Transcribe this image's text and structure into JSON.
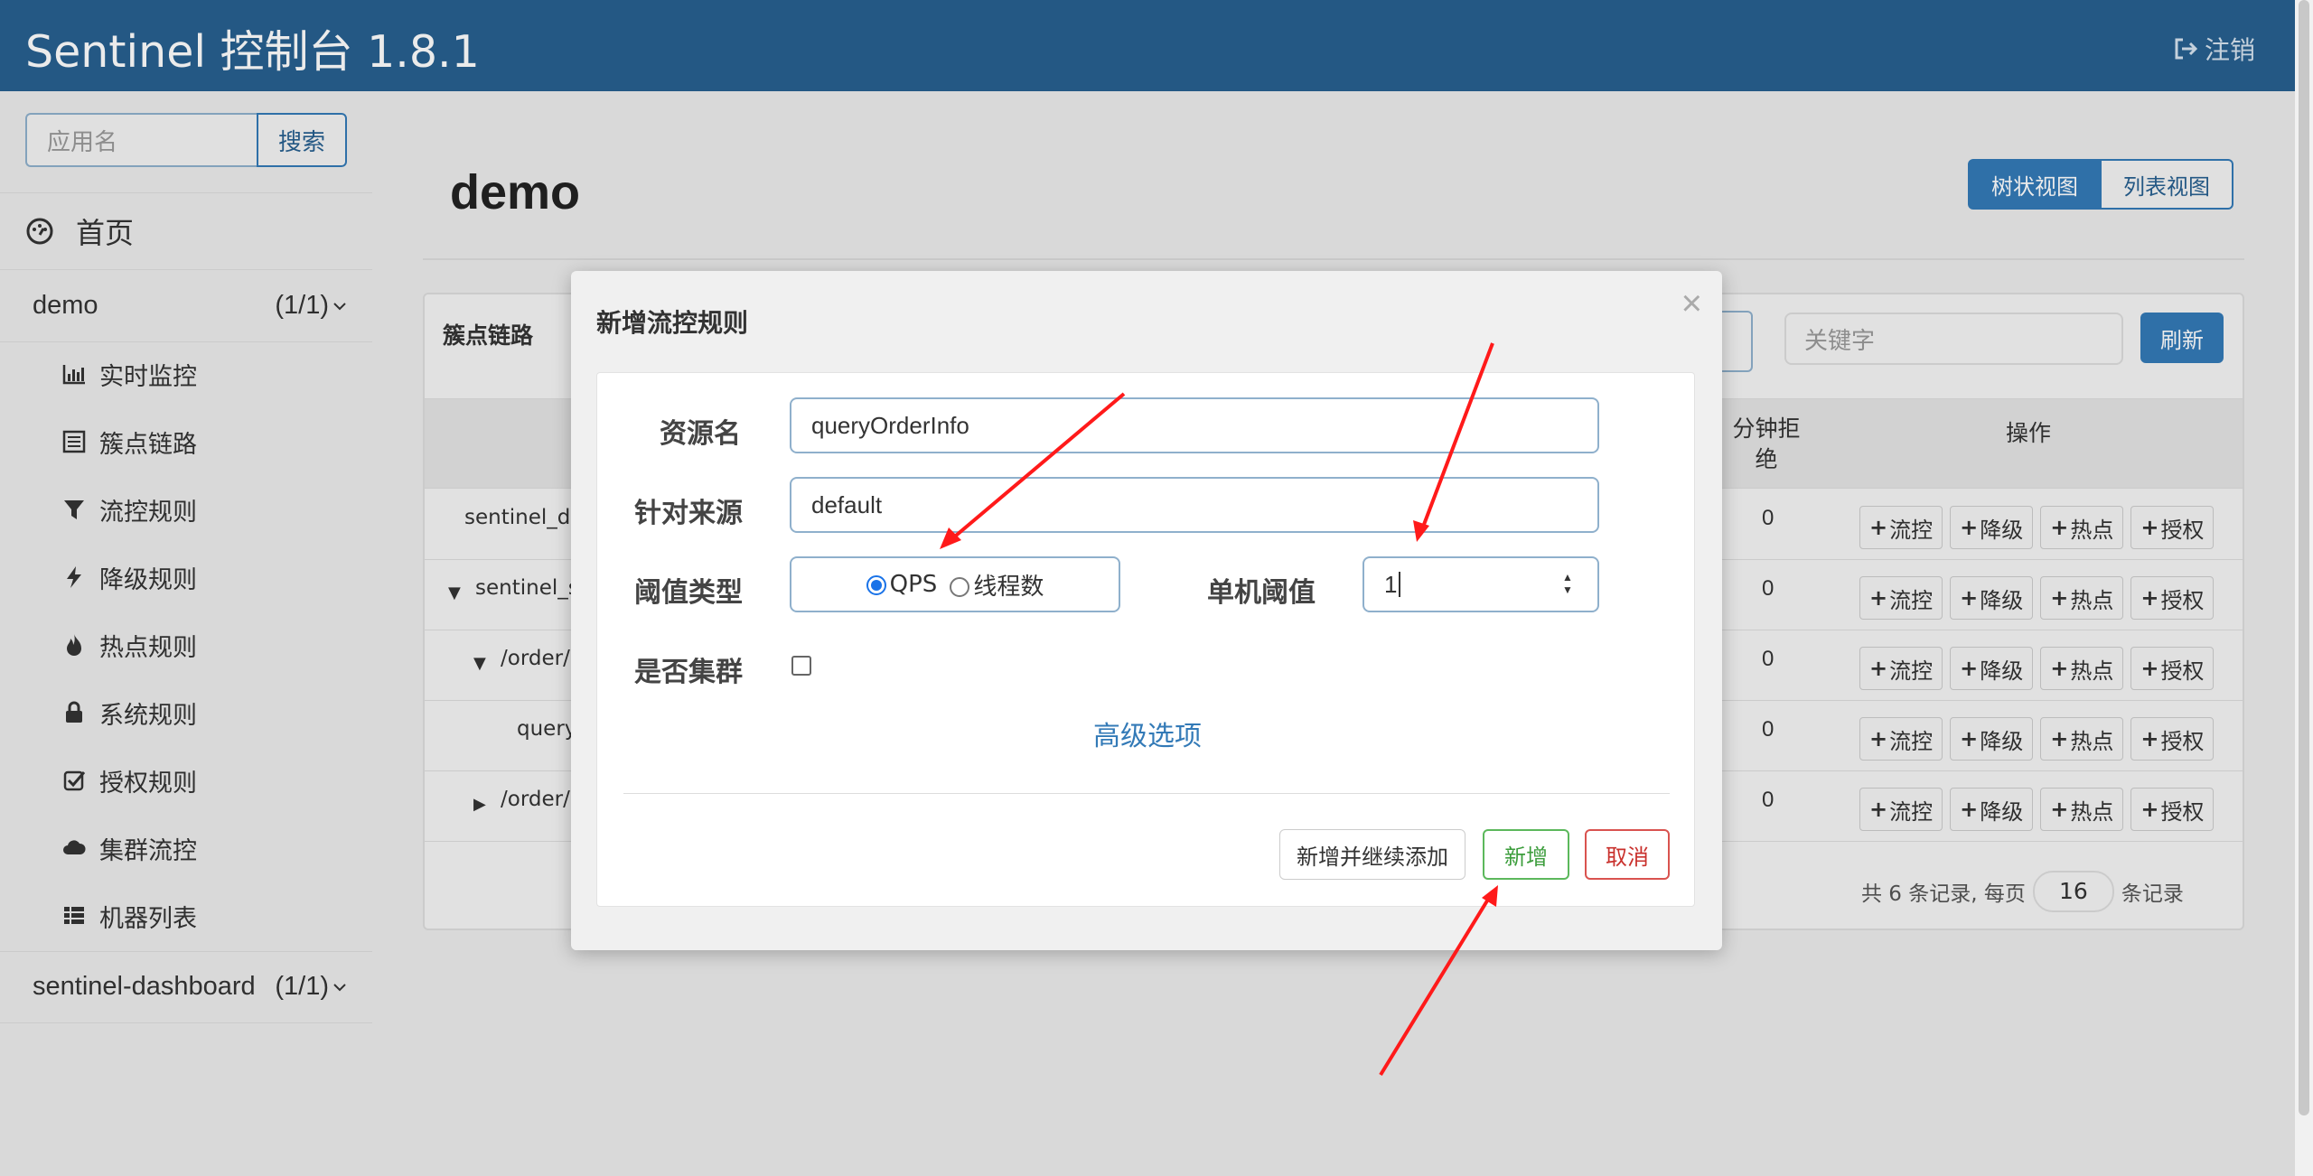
{
  "header": {
    "title": "Sentinel 控制台 1.8.1",
    "logout_label": "注销"
  },
  "sidebar": {
    "search_placeholder": "应用名",
    "search_button": "搜索",
    "home_label": "首页",
    "apps": [
      {
        "name": "demo",
        "count": "(1/1)"
      },
      {
        "name": "sentinel-dashboard",
        "count": "(1/1)"
      }
    ],
    "menu": [
      {
        "label": "实时监控",
        "icon": "bar-chart-icon"
      },
      {
        "label": "簇点链路",
        "icon": "list-alt-icon"
      },
      {
        "label": "流控规则",
        "icon": "filter-icon"
      },
      {
        "label": "降级规则",
        "icon": "flash-icon"
      },
      {
        "label": "热点规则",
        "icon": "fire-icon"
      },
      {
        "label": "系统规则",
        "icon": "lock-icon"
      },
      {
        "label": "授权规则",
        "icon": "check-icon"
      },
      {
        "label": "集群流控",
        "icon": "cloud-icon"
      },
      {
        "label": "机器列表",
        "icon": "th-list-icon"
      }
    ]
  },
  "main": {
    "title": "demo",
    "view_tree": "树状视图",
    "view_list": "列表视图",
    "panel_title": "簇点链路",
    "keyword_placeholder": "关键字",
    "refresh_button": "刷新",
    "col_reject": "分钟拒绝",
    "col_ops": "操作",
    "rows": [
      {
        "name": "sentinel_de",
        "value": "0"
      },
      {
        "name": "sentinel_sp",
        "value": "0"
      },
      {
        "name": "/order/ge",
        "value": "0"
      },
      {
        "name": "query",
        "value": "0"
      },
      {
        "name": "/order/ge",
        "value": "0"
      }
    ],
    "op_labels": [
      "流控",
      "降级",
      "热点",
      "授权"
    ],
    "paging": {
      "prefix": "共 6 条记录, 每页",
      "page_size": "16",
      "suffix": "条记录"
    }
  },
  "modal": {
    "title": "新增流控规则",
    "resource_label": "资源名",
    "resource_value": "queryOrderInfo",
    "origin_label": "针对来源",
    "origin_value": "default",
    "threshold_type_label": "阈值类型",
    "qps_label": "QPS",
    "threads_label": "线程数",
    "threshold_label": "单机阈值",
    "threshold_value": "1",
    "cluster_label": "是否集群",
    "advanced_label": "高级选项",
    "btn_add_continue": "新增并继续添加",
    "btn_add": "新增",
    "btn_cancel": "取消"
  },
  "colors": {
    "header": "#286090",
    "primary": "#337ab7",
    "success": "#5cb85c",
    "danger": "#d9534f",
    "annotation_arrow": "#ff1a1a"
  }
}
